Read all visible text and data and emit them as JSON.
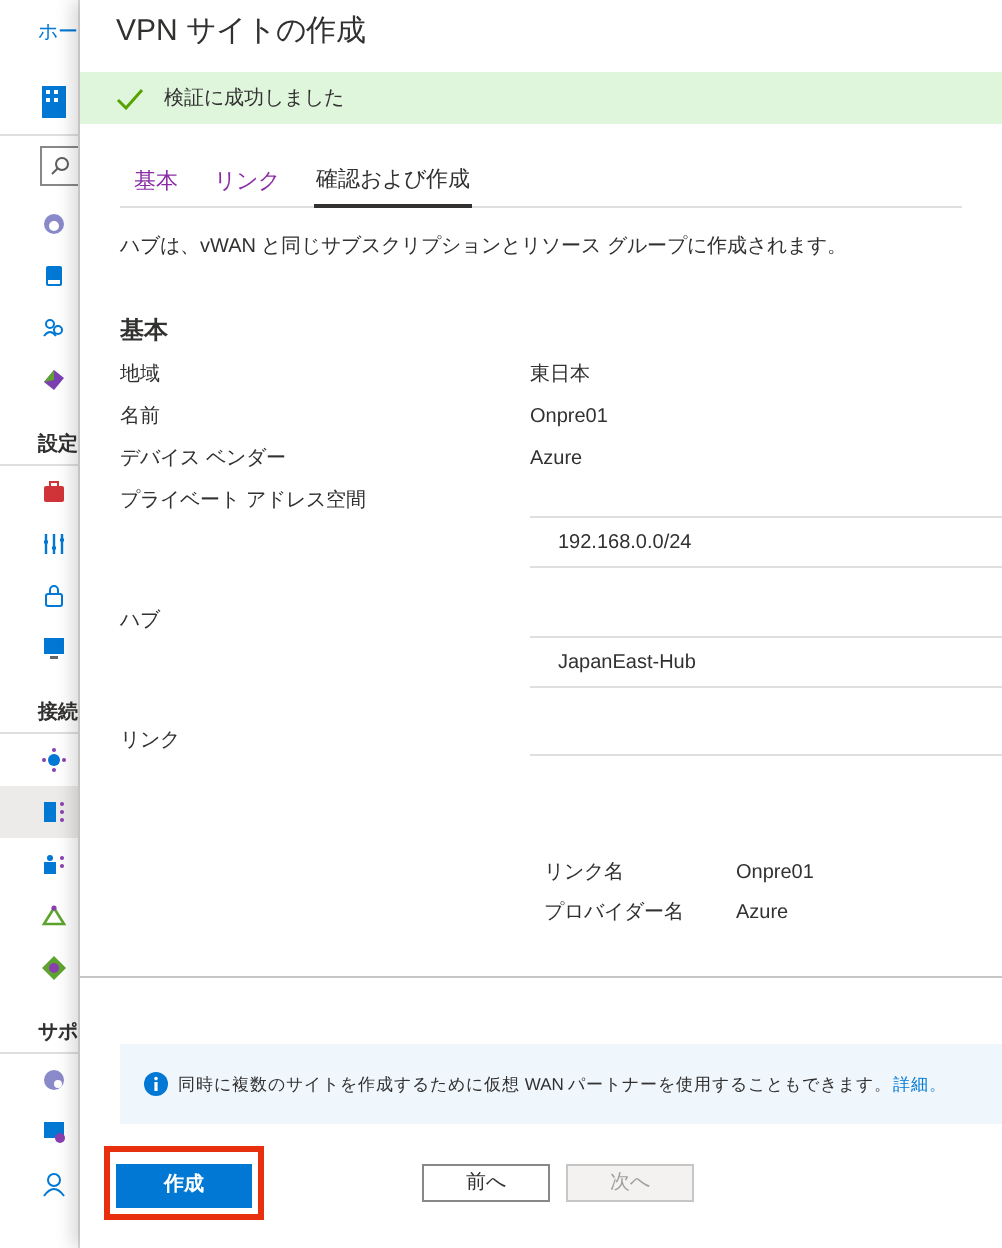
{
  "background_blade": {
    "breadcrumb": "ホー",
    "sections": [
      {
        "items": [
          {
            "selected": false
          },
          {
            "selected": false
          },
          {
            "selected": false
          },
          {
            "selected": false
          }
        ]
      },
      {
        "title": "設定",
        "items": [
          {
            "selected": false
          },
          {
            "selected": false
          },
          {
            "selected": false
          },
          {
            "selected": false
          }
        ]
      },
      {
        "title": "接続",
        "items": [
          {
            "selected": false
          },
          {
            "selected": true
          },
          {
            "selected": false
          },
          {
            "selected": false
          },
          {
            "selected": false
          }
        ]
      },
      {
        "title": "サポ",
        "items": [
          {
            "selected": false
          },
          {
            "selected": false
          },
          {
            "selected": false
          }
        ]
      }
    ]
  },
  "panel": {
    "title": "VPN サイトの作成",
    "banner": "検証に成功しました",
    "tabs": [
      {
        "label": "基本",
        "selected": false
      },
      {
        "label": "リンク",
        "selected": false
      },
      {
        "label": "確認および作成",
        "selected": true
      }
    ],
    "description": "ハブは、vWAN と同じサブスクリプションとリソース グループに作成されます。",
    "section_title": "基本",
    "fields": [
      {
        "kind": "text",
        "label": "地域",
        "value": "東日本"
      },
      {
        "kind": "text",
        "label": "名前",
        "value": "Onpre01"
      },
      {
        "kind": "text",
        "label": "デバイス ベンダー",
        "value": "Azure"
      },
      {
        "kind": "table",
        "label": "プライベート アドレス空間",
        "value": "192.168.0.0/24"
      },
      {
        "kind": "table",
        "label": "ハブ",
        "value": "JapanEast-Hub"
      },
      {
        "kind": "links",
        "label": "リンク",
        "rows": [
          {
            "label": "リンク名",
            "value": "Onpre01"
          },
          {
            "label": "プロバイダー名",
            "value": "Azure"
          }
        ]
      }
    ],
    "info": {
      "text": "同時に複数のサイトを作成するために仮想 WAN パートナーを使用することもできます。",
      "link": "詳細。"
    },
    "buttons": [
      {
        "kind": "primary",
        "label": "作成",
        "highlighted": true
      },
      {
        "kind": "secondary",
        "label": "前へ",
        "disabled": false
      },
      {
        "kind": "secondary",
        "label": "次へ",
        "disabled": true
      }
    ]
  }
}
